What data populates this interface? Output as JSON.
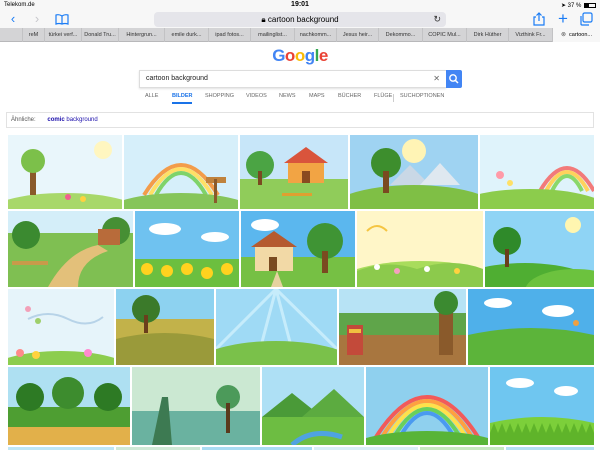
{
  "status": {
    "carrier": "Telekom.de",
    "time": "19:01",
    "battery": "37 %",
    "battery_level": 0.37
  },
  "address": {
    "url": "cartoon background"
  },
  "tabs": [
    {
      "label": "reM"
    },
    {
      "label": "türkei verf..."
    },
    {
      "label": "Donald Tru..."
    },
    {
      "label": "Hintergrun..."
    },
    {
      "label": "emile durk..."
    },
    {
      "label": "ipad fotos..."
    },
    {
      "label": "mailinglist..."
    },
    {
      "label": "nachkomm..."
    },
    {
      "label": "Jesus heir..."
    },
    {
      "label": "Dekommo..."
    },
    {
      "label": "COPIC Mul..."
    },
    {
      "label": "Dirk Hüther"
    },
    {
      "label": "Vizthink Fr..."
    },
    {
      "label": "cartoon..."
    }
  ],
  "logo": {
    "text": "Google",
    "colors": [
      "#4285f4",
      "#ea4335",
      "#fbbc05",
      "#4285f4",
      "#34a853",
      "#ea4335"
    ]
  },
  "search": {
    "value": "cartoon background"
  },
  "nav": [
    {
      "label": "ALLE"
    },
    {
      "label": "BILDER"
    },
    {
      "label": "SHOPPING"
    },
    {
      "label": "VIDEOS"
    },
    {
      "label": "NEWS"
    },
    {
      "label": "MAPS"
    },
    {
      "label": "BÜCHER"
    },
    {
      "label": "FLÜGE"
    },
    {
      "label": "SUCHOPTIONEN"
    }
  ],
  "related": {
    "label": "Ähnliche:",
    "prefix": "comic",
    "suffix": "background"
  },
  "accent": "#4285f4"
}
